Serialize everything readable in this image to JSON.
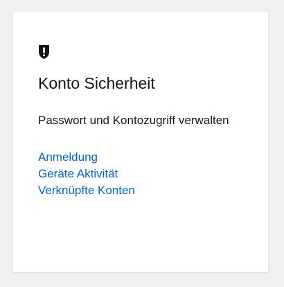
{
  "card": {
    "icon": "shield-exclamation-icon",
    "title": "Konto Sicherheit",
    "description": "Passwort und Kontozugriff verwalten",
    "links": [
      {
        "label": "Anmeldung"
      },
      {
        "label": "Geräte Aktivität"
      },
      {
        "label": "Verknüpfte Konten"
      }
    ]
  },
  "colors": {
    "background": "#f0f0f0",
    "card": "#ffffff",
    "text": "#151515",
    "link": "#0066cc"
  }
}
